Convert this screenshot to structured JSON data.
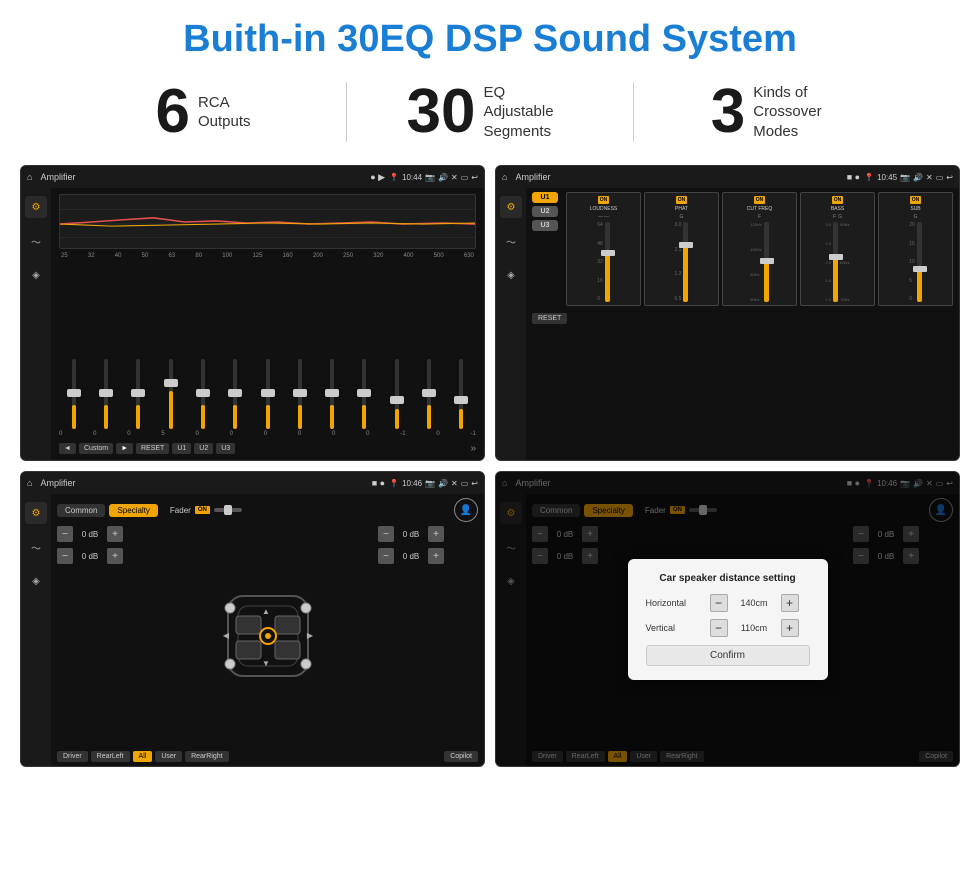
{
  "page": {
    "title": "Buith-in 30EQ DSP Sound System",
    "bg_color": "#ffffff"
  },
  "stats": [
    {
      "number": "6",
      "label": "RCA\nOutputs"
    },
    {
      "number": "30",
      "label": "EQ Adjustable\nSegments"
    },
    {
      "number": "3",
      "label": "Kinds of\nCrossover Modes"
    }
  ],
  "screens": {
    "eq": {
      "title": "Amplifier",
      "time": "10:44",
      "freq_labels": [
        "25",
        "32",
        "40",
        "50",
        "63",
        "80",
        "100",
        "125",
        "160",
        "200",
        "250",
        "320",
        "400",
        "500",
        "630"
      ],
      "slider_values": [
        "0",
        "0",
        "0",
        "5",
        "0",
        "0",
        "0",
        "0",
        "0",
        "0",
        "-1",
        "0",
        "-1"
      ],
      "bottom_buttons": [
        "◄",
        "Custom",
        "►",
        "RESET",
        "U1",
        "U2",
        "U3"
      ]
    },
    "crossover": {
      "title": "Amplifier",
      "time": "10:45",
      "presets": [
        "U1",
        "U2",
        "U3"
      ],
      "panels": [
        {
          "on": true,
          "name": "LOUDNESS"
        },
        {
          "on": true,
          "name": "PHAT"
        },
        {
          "on": true,
          "name": "CUT FREQ"
        },
        {
          "on": true,
          "name": "BASS"
        },
        {
          "on": true,
          "name": "SUB"
        }
      ],
      "reset_label": "RESET"
    },
    "speaker1": {
      "title": "Amplifier",
      "time": "10:46",
      "tabs": [
        "Common",
        "Specialty"
      ],
      "active_tab": "Specialty",
      "fader_label": "Fader",
      "on_label": "ON",
      "db_controls": [
        {
          "label": "0 dB"
        },
        {
          "label": "0 dB"
        },
        {
          "label": "0 dB"
        },
        {
          "label": "0 dB"
        }
      ],
      "bottom_buttons": [
        "Driver",
        "RearLeft",
        "All",
        "User",
        "RearRight",
        "Copilot"
      ]
    },
    "speaker2": {
      "title": "Amplifier",
      "time": "10:46",
      "tabs": [
        "Common",
        "Specialty"
      ],
      "active_tab": "Specialty",
      "fader_label": "Fader",
      "on_label": "ON",
      "modal": {
        "title": "Car speaker distance setting",
        "horizontal_label": "Horizontal",
        "horizontal_value": "140cm",
        "vertical_label": "Vertical",
        "vertical_value": "110cm",
        "confirm_label": "Confirm"
      },
      "db_controls": [
        {
          "label": "0 dB"
        },
        {
          "label": "0 dB"
        }
      ],
      "bottom_buttons": [
        "Driver",
        "RearLeft",
        "All",
        "User",
        "RearRight",
        "Copilot"
      ]
    }
  }
}
